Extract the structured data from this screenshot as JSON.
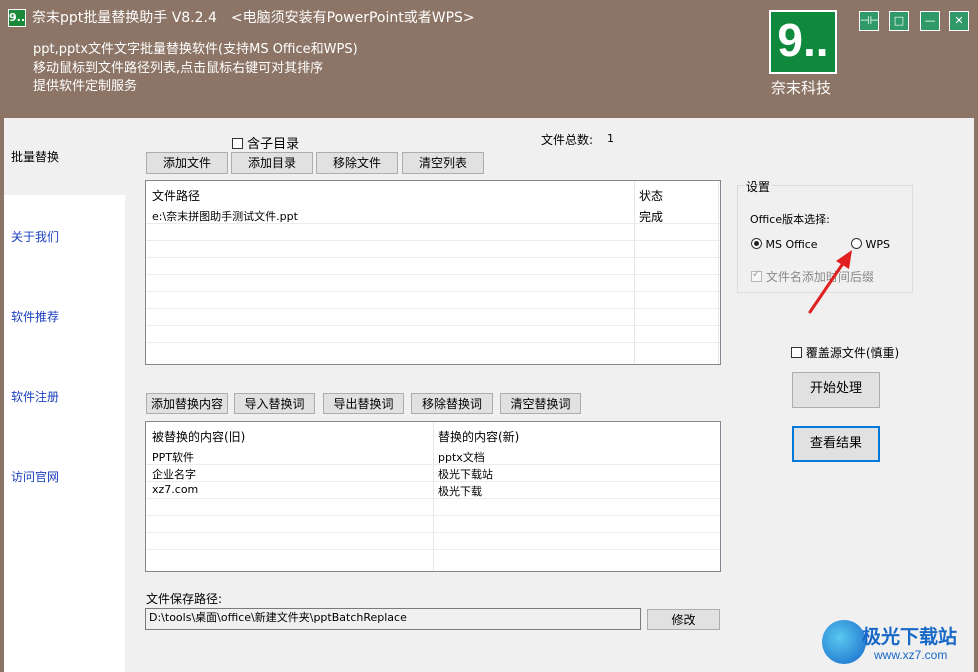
{
  "window": {
    "app_icon": "9..",
    "title": "奈末ppt批量替换助手 V8.2.4",
    "title_note": "<电脑须安装有PowerPoint或者WPS>",
    "info_lines": [
      "ppt,pptx文件文字批量替换软件(支持MS Office和WPS)",
      "移动鼠标到文件路径列表,点击鼠标右键可对其排序",
      "提供软件定制服务"
    ],
    "logo_glyph": "9..",
    "logo_text": "奈末科技",
    "controls": {
      "pin": "⊣⊢",
      "restore": "□",
      "minimize": "—",
      "close": "✕"
    }
  },
  "sidebar": {
    "items": [
      {
        "label": "批量替换",
        "active": true
      },
      {
        "label": "关于我们"
      },
      {
        "label": "软件推荐"
      },
      {
        "label": "软件注册"
      },
      {
        "label": "访问官网"
      }
    ]
  },
  "files": {
    "include_subdirs_label": "含子目录",
    "total_label": "文件总数:",
    "total_value": "1",
    "buttons": [
      "添加文件",
      "添加目录",
      "移除文件",
      "清空列表"
    ],
    "columns": [
      "文件路径",
      "状态"
    ],
    "rows": [
      {
        "path": "e:\\奈末拼图助手测试文件.ppt",
        "status": "完成"
      }
    ]
  },
  "replace": {
    "buttons": [
      "添加替换内容",
      "导入替换词",
      "导出替换词",
      "移除替换词",
      "清空替换词"
    ],
    "columns": [
      "被替换的内容(旧)",
      "替换的内容(新)"
    ],
    "rows": [
      {
        "old": "PPT软件",
        "new": "pptx文档"
      },
      {
        "old": "企业名字",
        "new": "极光下载站"
      },
      {
        "old": "xz7.com",
        "new": "极光下载"
      }
    ]
  },
  "save": {
    "label": "文件保存路径:",
    "path": "D:\\tools\\桌面\\office\\新建文件夹\\pptBatchReplace",
    "modify_label": "修改"
  },
  "settings": {
    "legend": "设置",
    "office_label": "Office版本选择:",
    "options": [
      {
        "label": "MS Office",
        "selected": true
      },
      {
        "label": "WPS",
        "selected": false
      }
    ],
    "timestamp_suffix_label": "文件名添加时间后缀",
    "timestamp_suffix_checked": true
  },
  "actions": {
    "overwrite_label": "覆盖源文件(慎重)",
    "start_label": "开始处理",
    "view_label": "查看结果"
  },
  "watermark": {
    "text": "极光下载站",
    "url": "www.xz7.com"
  },
  "colors": {
    "header_bg": "#8c7566",
    "logo_green": "#0f8a3c",
    "link_blue": "#1a3fbf",
    "annotation_red": "#e02020"
  }
}
